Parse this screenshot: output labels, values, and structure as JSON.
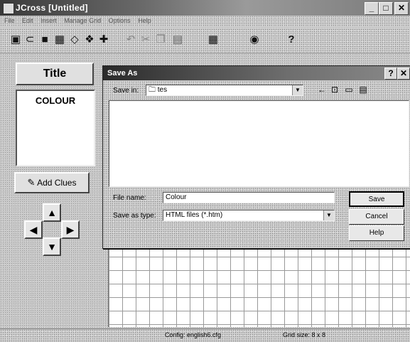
{
  "app": {
    "title": "JCross [Untitled]",
    "window_buttons": [
      "_",
      "□",
      "✕"
    ],
    "menu": [
      "File",
      "Edit",
      "Insert",
      "Manage Grid",
      "Options",
      "Help"
    ]
  },
  "toolbar": {
    "icons": [
      "new-icon",
      "open-icon",
      "save-icon",
      "save-as-icon",
      "erase-icon",
      "export-icon",
      "pin-icon",
      "undo-icon",
      "cut-icon",
      "copy-icon",
      "paste-icon",
      "grid-icon",
      "web-icon",
      "help-icon"
    ],
    "help_label": "?"
  },
  "left_panel": {
    "title_button": "Title",
    "words": [
      "COLOUR"
    ],
    "add_clues_button": "Add Clues",
    "arrows": {
      "up": "▲",
      "left": "◀",
      "right": "▶",
      "down": "▼"
    }
  },
  "status": {
    "config": "Config: english6.cfg",
    "grid_size": "Grid size: 8 x 8"
  },
  "dialog": {
    "title": "Save As",
    "help_btn": "?",
    "close_btn": "✕",
    "save_in_label": "Save in:",
    "save_in_value": "tes",
    "file_name_label": "File name:",
    "file_name_value": "Colour",
    "save_type_label": "Save as type:",
    "save_type_value": "HTML files (*.htm)",
    "save_button": "Save",
    "cancel_button": "Cancel",
    "help_button": "Help"
  }
}
